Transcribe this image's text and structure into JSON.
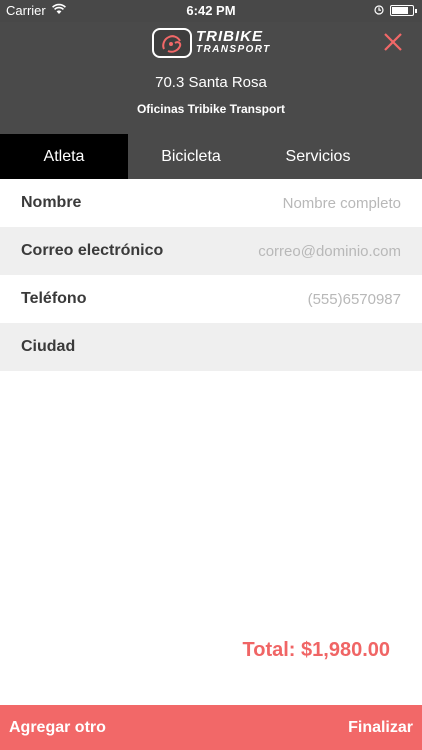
{
  "status_bar": {
    "carrier": "Carrier",
    "time": "6:42 PM",
    "battery_level": 0.8
  },
  "header": {
    "logo_line1": "TRIBIKE",
    "logo_line2": "TRANSPORT",
    "event_title": "70.3 Santa Rosa",
    "event_subtitle": "Oficinas Tribike Transport"
  },
  "tabs": [
    {
      "label": "Atleta",
      "active": true
    },
    {
      "label": "Bicicleta",
      "active": false
    },
    {
      "label": "Servicios",
      "active": false
    }
  ],
  "form": {
    "rows": [
      {
        "label": "Nombre",
        "value": "",
        "placeholder": "Nombre completo"
      },
      {
        "label": "Correo electrónico",
        "value": "",
        "placeholder": "correo@dominio.com"
      },
      {
        "label": "Teléfono",
        "value": "",
        "placeholder": "(555)6570987"
      },
      {
        "label": "Ciudad",
        "value": "",
        "placeholder": ""
      }
    ]
  },
  "total": {
    "label": "Total:",
    "amount": "$1,980.00"
  },
  "footer": {
    "add_label": "Agregar otro",
    "finish_label": "Finalizar"
  },
  "colors": {
    "accent": "#f26868",
    "header_bg": "#4a4a4a",
    "active_tab": "#000000",
    "row_alt": "#efefef"
  },
  "icons": {
    "wifi": "wifi-icon",
    "battery": "battery-icon",
    "close": "close-icon",
    "logo": "tribike-logo-icon"
  }
}
